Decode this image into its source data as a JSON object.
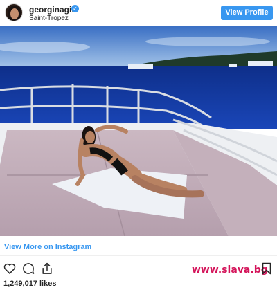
{
  "header": {
    "username": "georginagio",
    "location": "Saint-Tropez",
    "view_profile_label": "View Profile"
  },
  "links": {
    "view_more_label": "View More on Instagram"
  },
  "stats": {
    "likes_text": "1,249,017 likes"
  },
  "watermark": {
    "text": "www.slava.bg"
  },
  "icons": [
    "verified-badge-icon",
    "heart-icon",
    "comment-icon",
    "share-icon",
    "bookmark-icon"
  ],
  "colors": {
    "accent": "#3897f0",
    "watermark": "#d4145a"
  }
}
